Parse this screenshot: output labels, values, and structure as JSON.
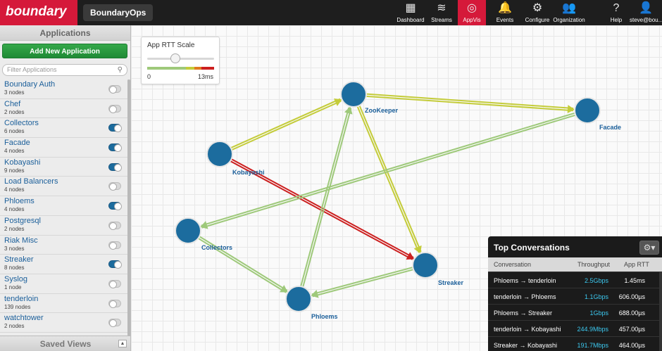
{
  "topbar": {
    "logo_text": "boundary",
    "app_title": "BoundaryOps",
    "nav": [
      {
        "label": "Dashboard",
        "icon": "grid-icon",
        "glyph": "▦",
        "active": false
      },
      {
        "label": "Streams",
        "icon": "streams-icon",
        "glyph": "≋",
        "active": false
      },
      {
        "label": "AppVis",
        "icon": "appvis-icon",
        "glyph": "◎",
        "active": true
      },
      {
        "label": "Events",
        "icon": "bell-icon",
        "glyph": "🔔",
        "active": false
      },
      {
        "label": "Configure",
        "icon": "gear-icon",
        "glyph": "⚙",
        "active": false
      },
      {
        "label": "Organization",
        "icon": "people-icon",
        "glyph": "👥",
        "active": false
      },
      {
        "label": "Help",
        "icon": "help-icon",
        "glyph": "?",
        "active": false
      },
      {
        "label": "steve@bou...",
        "icon": "user-icon",
        "glyph": "👤",
        "active": false
      }
    ],
    "accent_color": "#d5193a"
  },
  "sidebar": {
    "title": "Applications",
    "add_button": "Add New Application",
    "filter_placeholder": "Filter Applications",
    "apps": [
      {
        "name": "Boundary Auth",
        "nodes": "3 nodes",
        "enabled": false
      },
      {
        "name": "Chef",
        "nodes": "2 nodes",
        "enabled": false
      },
      {
        "name": "Collectors",
        "nodes": "6 nodes",
        "enabled": true
      },
      {
        "name": "Facade",
        "nodes": "4 nodes",
        "enabled": true
      },
      {
        "name": "Kobayashi",
        "nodes": "9 nodes",
        "enabled": true
      },
      {
        "name": "Load Balancers",
        "nodes": "4 nodes",
        "enabled": false
      },
      {
        "name": "Phloems",
        "nodes": "4 nodes",
        "enabled": true
      },
      {
        "name": "Postgresql",
        "nodes": "2 nodes",
        "enabled": false
      },
      {
        "name": "Riak Misc",
        "nodes": "3 nodes",
        "enabled": false
      },
      {
        "name": "Streaker",
        "nodes": "8 nodes",
        "enabled": true
      },
      {
        "name": "Syslog",
        "nodes": "1 node",
        "enabled": false
      },
      {
        "name": "tenderloin",
        "nodes": "139 nodes",
        "enabled": false
      },
      {
        "name": "watchtower",
        "nodes": "2 nodes",
        "enabled": false
      }
    ],
    "saved_views": "Saved Views"
  },
  "rtt_scale": {
    "title": "App RTT Scale",
    "min": "0",
    "max": "13ms",
    "slider_fraction": 0.42
  },
  "graph": {
    "nodes": [
      {
        "id": "zookeeper",
        "label": "ZooKeeper"
      },
      {
        "id": "facade",
        "label": "Facade"
      },
      {
        "id": "kobayashi",
        "label": "Kobayashi"
      },
      {
        "id": "collectors",
        "label": "Collectors"
      },
      {
        "id": "streaker",
        "label": "Streaker"
      },
      {
        "id": "phloems",
        "label": "Phloems"
      }
    ],
    "edges": [
      {
        "from": "kobayashi",
        "to": "zookeeper",
        "color": "#c4cc3a"
      },
      {
        "from": "zookeeper",
        "to": "facade",
        "color": "#c4cc3a"
      },
      {
        "from": "zookeeper",
        "to": "streaker",
        "color": "#c4cc3a"
      },
      {
        "from": "kobayashi",
        "to": "streaker",
        "color": "#cc1f1f"
      },
      {
        "from": "phloems",
        "to": "zookeeper",
        "color": "#9ec97a"
      },
      {
        "from": "facade",
        "to": "collectors",
        "color": "#9ec97a"
      },
      {
        "from": "collectors",
        "to": "phloems",
        "color": "#9ec97a"
      },
      {
        "from": "streaker",
        "to": "phloems",
        "color": "#9ec97a"
      }
    ]
  },
  "conversations": {
    "title": "Top Conversations",
    "columns": [
      "Conversation",
      "Throughput",
      "App RTT"
    ],
    "rows": [
      {
        "conversation": "Phloems → tenderloin",
        "throughput": "2.5Gbps",
        "rtt": "1.45ms"
      },
      {
        "conversation": "tenderloin → Phloems",
        "throughput": "1.1Gbps",
        "rtt": "606.00µs"
      },
      {
        "conversation": "Phloems → Streaker",
        "throughput": "1Gbps",
        "rtt": "688.00µs"
      },
      {
        "conversation": "tenderloin → Kobayashi",
        "throughput": "244.9Mbps",
        "rtt": "457.00µs"
      },
      {
        "conversation": "Streaker → Kobayashi",
        "throughput": "191.7Mbps",
        "rtt": "464.00µs"
      }
    ]
  }
}
